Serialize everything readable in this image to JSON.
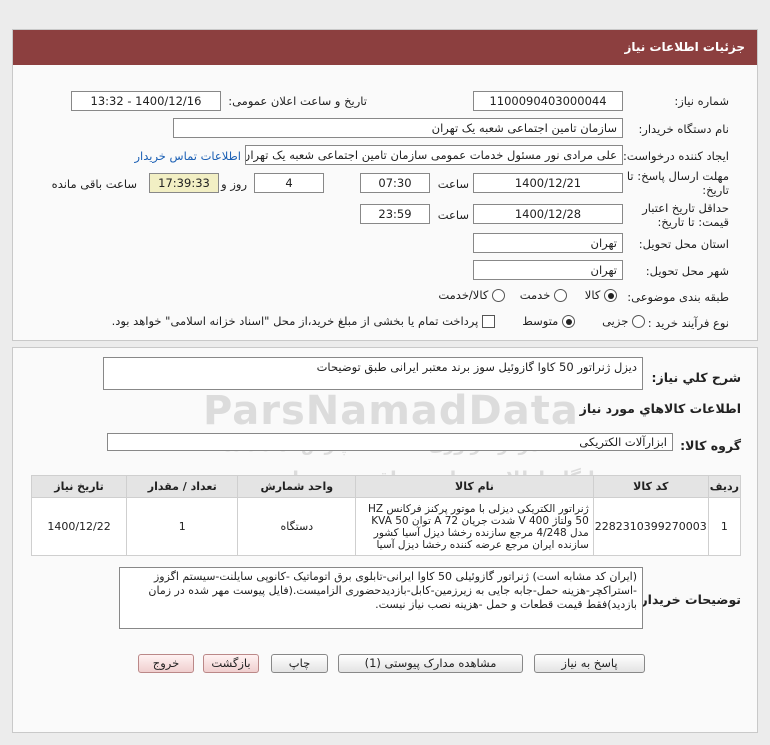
{
  "title": "جزئیات اطلاعات نیاز",
  "labels": {
    "need_number": "شماره نیاز:",
    "announce_datetime": "تاریخ و ساعت اعلان عمومی:",
    "buyer_org": "نام دستگاه خریدار:",
    "requester": "ایجاد کننده درخواست:",
    "reply_deadline_line1": "مهلت ارسال پاسخ: تا",
    "reply_deadline_line2": "تاریخ:",
    "time": "ساعت",
    "days_and": "روز و",
    "remaining": "ساعت باقی مانده",
    "price_validity_line1": "حداقل تاریخ اعتبار",
    "price_validity_line2": "قیمت: تا تاریخ:",
    "delivery_province": "استان محل تحویل:",
    "delivery_city": "شهر محل تحویل:",
    "subject_category": "طبقه بندی موضوعی:",
    "purchase_process": "نوع فرآیند خرید :",
    "general_desc": "شرح کلي نياز:",
    "goods_info": "اطلاعات کالاهاي مورد نياز",
    "goods_group": "گروه کالا:",
    "buyer_notes": "توضیحات خریدار:"
  },
  "fields": {
    "need_number": "1100090403000044",
    "announce_datetime": "1400/12/16 - 13:32",
    "buyer_org": "سازمان تامین اجتماعی شعبه یک تهران",
    "requester": "علی مرادی نور مسئول خدمات عمومی سازمان تامین اجتماعی شعبه یک تهران",
    "contact_link": "اطلاعات تماس خریدار",
    "reply_date": "1400/12/21",
    "reply_time": "07:30",
    "reply_days": "4",
    "reply_remaining": "17:39:33",
    "validity_date": "1400/12/28",
    "validity_time": "23:59",
    "province": "تهران",
    "city": "تهران"
  },
  "category_options": [
    {
      "label": "کالا",
      "selected": true
    },
    {
      "label": "خدمت",
      "selected": false
    },
    {
      "label": "کالا/خدمت",
      "selected": false
    }
  ],
  "process_options": [
    {
      "label": "جزیی",
      "selected": false
    },
    {
      "label": "متوسط",
      "selected": true
    }
  ],
  "payment_note": "پرداخت تمام یا بخشی از مبلغ خرید،از محل \"اسناد خزانه اسلامی\" خواهد بود.",
  "general_desc": "دیزل ژنراتور 50 کاوا گازوئیل سوز برند معتبر ایرانی طبق توضیحات",
  "goods_group": "ابزارآلات الکتریکی",
  "table": {
    "headers": [
      "ردیف",
      "کد کالا",
      "نام کالا",
      "واحد شمارش",
      "تعداد / مقدار",
      "تاریخ نیاز"
    ],
    "rows": [
      {
        "row": "1",
        "code": "2282310399270003",
        "name": "ژنراتور الکتریکی دیزلی با موتور پرکنز فرکانس HZ 50 ولتاژ 400 V شدت جریان A 72 توان KVA 50 مدل 4/248 مرجع سازنده رخشا دیزل آسیا کشور سازنده ایران مرجع عرضه کننده رخشا دیزل آسیا",
        "unit": "دستگاه",
        "qty": "1",
        "date": "1400/12/22"
      }
    ]
  },
  "buyer_notes": "(ایران کد مشابه است) ژنراتور گازوئیلی 50 کاوا ایرانی-تابلوی برق اتوماتیک -کانوپی سایلنت-سیستم اگزوز -استراکچر-هزینه حمل-جابه جایی به زیرزمین-کابل-بازدیدحضوری الزامیست.(فایل پیوست مهر شده در زمان بازدید)فقط قیمت قطعات و حمل -هزینه نصب نیاز نیست.",
  "buttons": {
    "reply": "پاسخ به نیاز",
    "view_docs": "مشاهده مدارک پیوستی (1)",
    "print": "چاپ",
    "back": "بازگشت",
    "exit": "خروج"
  },
  "watermark": {
    "line1": "ParsNamadData",
    "line2": "مرکز فراوری اطلاعات پارس نماد داده",
    "line3": "پایگاه اطلاع رسانی مناقصه و مزایده",
    "line4": "۰۲۱-۸۸۳۴۶۰۰۰"
  },
  "colors": {
    "title_bar": "#8c3f3f",
    "link": "#1a5fb4",
    "remaining_bg": "#f2efc4"
  }
}
